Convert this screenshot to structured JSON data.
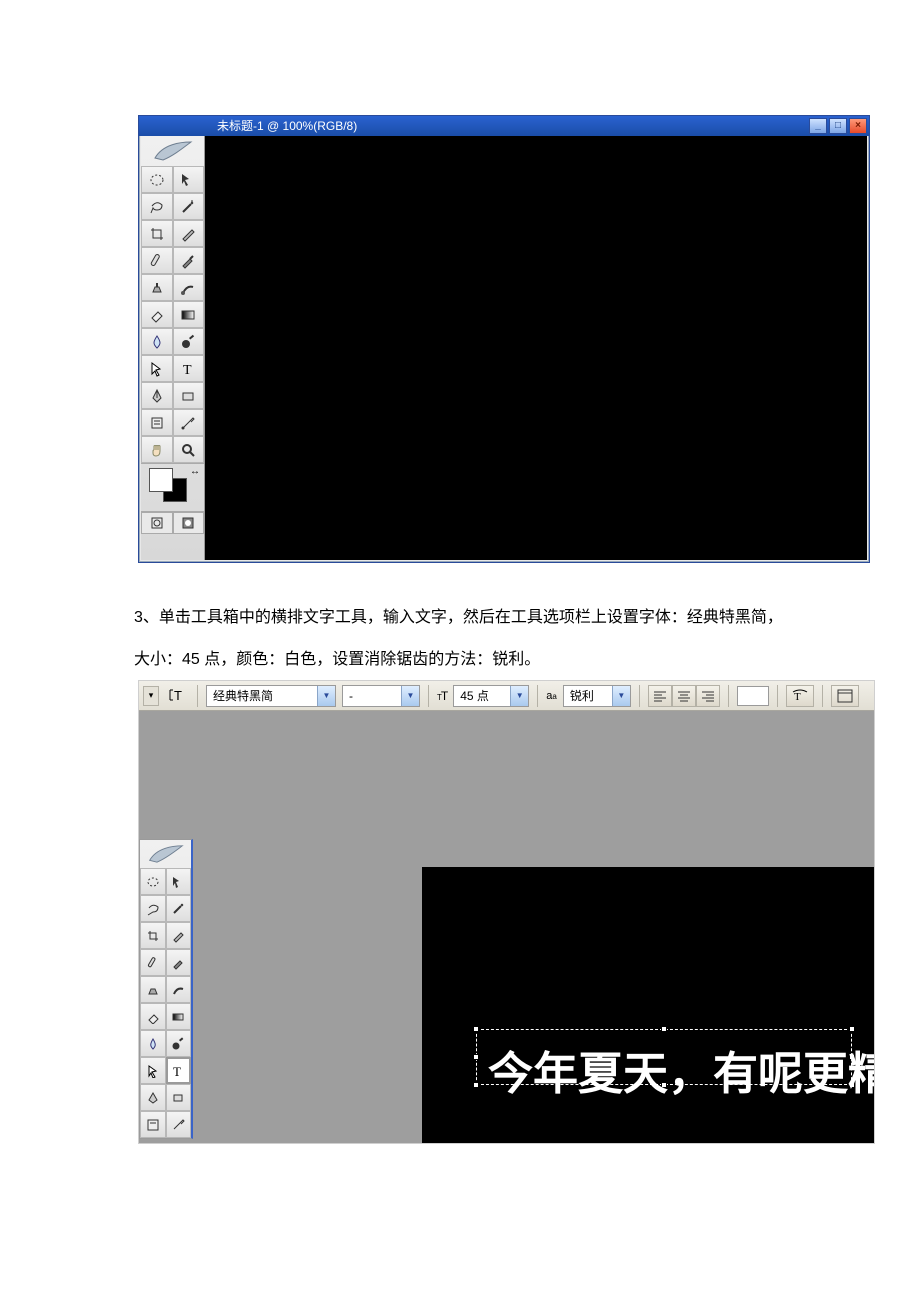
{
  "window": {
    "title": "未标题-1 @ 100%(RGB/8)",
    "btn_min": "_",
    "btn_max": "□",
    "btn_close": "×"
  },
  "caption": {
    "line1": "3、单击工具箱中的横排文字工具，输入文字，然后在工具选项栏上设置字体：经典特黑简，",
    "line2": "大小：45 点，颜色：白色，设置消除锯齿的方法：锐利。"
  },
  "options": {
    "font_family": "经典特黑简",
    "font_style": "-",
    "font_size": "45 点",
    "anti_alias": "锐利",
    "color": "#ffffff"
  },
  "text_layer": {
    "content": "今年夏天，有呢更精彩"
  }
}
